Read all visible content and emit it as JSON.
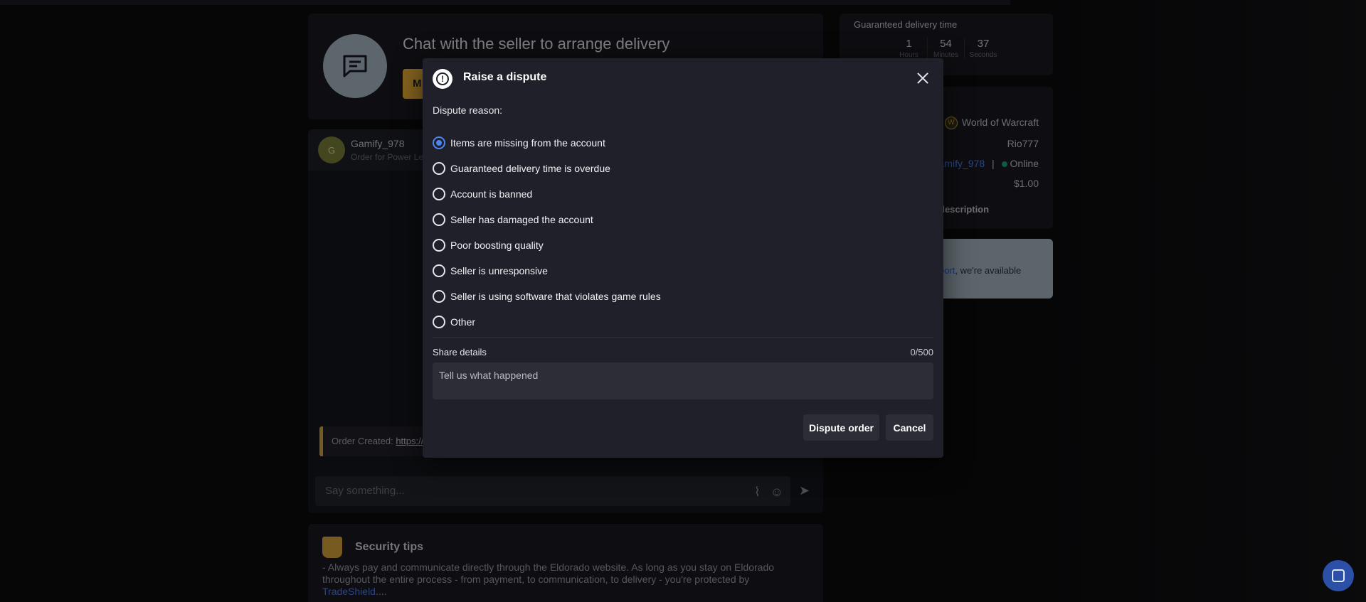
{
  "chat_header": {
    "title": "Chat with the seller to arrange delivery",
    "button_label": "M"
  },
  "chat": {
    "user_initial": "G",
    "user_name": "Gamify_978",
    "user_sub": "Order for Power Le",
    "order_created_label": "Order Created:",
    "order_created_link": "https://",
    "input_placeholder": "Say something..."
  },
  "security": {
    "title": "Security tips",
    "text": "- Always pay and communicate directly through the Eldorado website. As long as you stay on Eldorado throughout the entire process - from payment, to communication, to delivery - you're protected by",
    "link": "TradeShield",
    "ellipsis": "...."
  },
  "delivery": {
    "title": "Guaranteed delivery time",
    "timer": [
      {
        "value": "1",
        "label": "Hours"
      },
      {
        "value": "54",
        "label": "Minutes"
      },
      {
        "value": "37",
        "label": "Seconds"
      }
    ]
  },
  "order_info": {
    "game_badge": "W",
    "game": "World of Warcraft",
    "character": "Rio777",
    "seller": "Gamify_978",
    "separator": "|",
    "status": "Online",
    "price": "$1.00",
    "description_label": "description"
  },
  "support": {
    "link": "port",
    "text": ", we're available"
  },
  "modal": {
    "icon_glyph": "!",
    "title": "Raise a dispute",
    "reason_label": "Dispute reason:",
    "reasons": [
      {
        "label": "Items are missing from the account",
        "checked": true
      },
      {
        "label": "Guaranteed delivery time is overdue",
        "checked": false
      },
      {
        "label": "Account is banned",
        "checked": false
      },
      {
        "label": "Seller has damaged the account",
        "checked": false
      },
      {
        "label": "Poor boosting quality",
        "checked": false
      },
      {
        "label": "Seller is unresponsive",
        "checked": false
      },
      {
        "label": "Seller is using software that violates game rules",
        "checked": false
      },
      {
        "label": "Other",
        "checked": false
      }
    ],
    "share_label": "Share details",
    "share_count": "0/500",
    "details_placeholder": "Tell us what happened",
    "dispute_button": "Dispute order",
    "cancel_button": "Cancel"
  },
  "colors": {
    "accent": "#4d85f0",
    "brand_yellow": "#f1b43a",
    "online": "#1aa57b"
  }
}
